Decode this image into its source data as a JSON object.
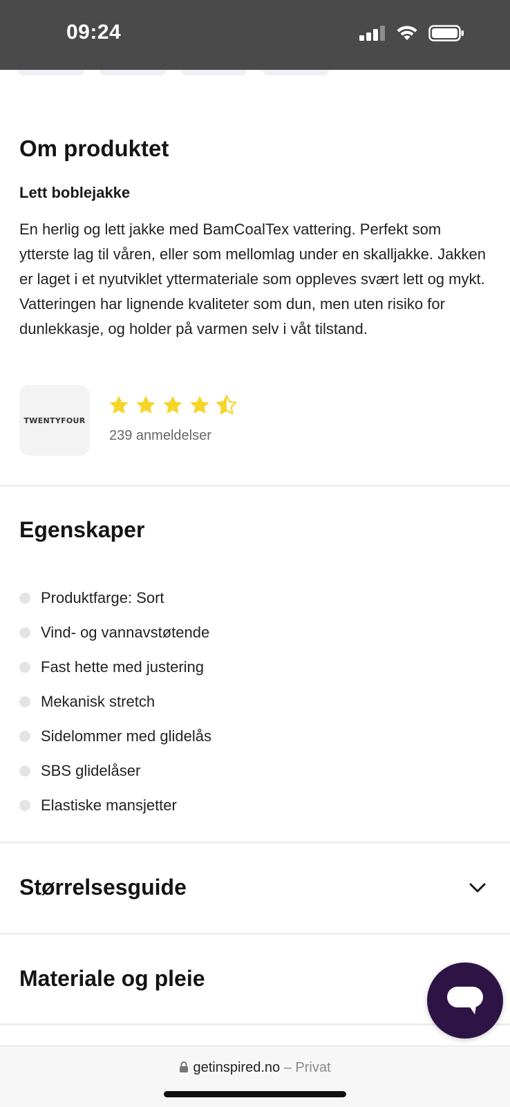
{
  "status_bar": {
    "time": "09:24"
  },
  "about": {
    "title": "Om produktet",
    "subtitle": "Lett boblejakke",
    "description": "En herlig og lett jakke med BamCoalTex vattering. Perfekt som ytterste lag til våren, eller som mellomlag under en skalljakke. Jakken er laget i et nyutviklet yttermateriale som oppleves svært lett og mykt. Vatteringen har lignende kvaliteter som dun, men uten risiko for dunlekkasje, og holder på varmen selv i våt tilstand.",
    "brand_logo_text": "TWENTYFOUR",
    "rating": 4.5,
    "reviews_text": "239 anmeldelser"
  },
  "features": {
    "title": "Egenskaper",
    "items": [
      "Produktfarge: Sort",
      "Vind- og vannavstøtende",
      "Fast hette med justering",
      "Mekanisk stretch",
      "Sidelommer med glidelås",
      "SBS glidelåser",
      "Elastiske mansjetter"
    ]
  },
  "accordions": {
    "size_guide": "Størrelsesguide",
    "material_care": "Materiale og pleie"
  },
  "browser": {
    "domain": "getinspired.no",
    "privacy": "– Privat"
  },
  "colors": {
    "star": "#f5d52a",
    "chat_button": "#2d1444"
  }
}
